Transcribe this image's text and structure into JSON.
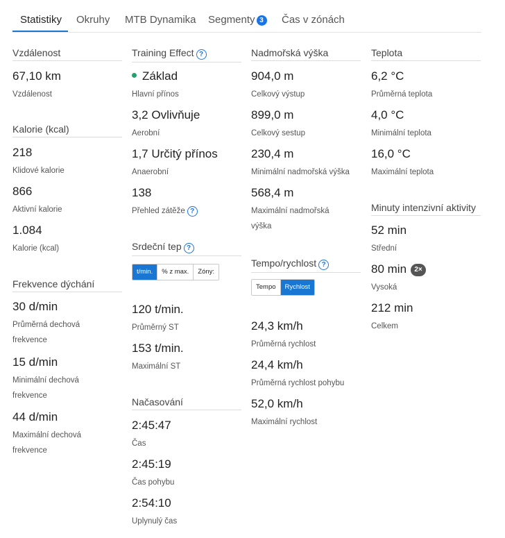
{
  "tabs": [
    {
      "label": "Statistiky"
    },
    {
      "label": "Okruhy"
    },
    {
      "label": "MTB Dynamika"
    },
    {
      "label": "Segmenty",
      "badge": "3"
    },
    {
      "label": "Čas v zónách"
    }
  ],
  "col1": {
    "distance": {
      "title": "Vzdálenost",
      "items": [
        {
          "value": "67,10 km",
          "label": "Vzdálenost"
        }
      ]
    },
    "calories": {
      "title": "Kalorie (kcal)",
      "items": [
        {
          "value": "218",
          "label": "Klidové kalorie"
        },
        {
          "value": "866",
          "label": "Aktivní kalorie"
        },
        {
          "value": "1.084",
          "label": "Kalorie (kcal)"
        }
      ]
    },
    "breathing": {
      "title": "Frekvence dýchání",
      "items": [
        {
          "value": "30 d/min",
          "label": "Průměrná dechová frekvence"
        },
        {
          "value": "15 d/min",
          "label": "Minimální dechová frekvence"
        },
        {
          "value": "44 d/min",
          "label": "Maximální dechová frekvence"
        }
      ]
    }
  },
  "col2": {
    "training": {
      "title": "Training Effect",
      "items": [
        {
          "value": "Základ",
          "label": "Hlavní přínos"
        },
        {
          "value": "3,2 Ovlivňuje",
          "label": "Aerobní"
        },
        {
          "value": "1,7 Určitý přínos",
          "label": "Anaerobní"
        },
        {
          "value": "138",
          "label": "Přehled zátěže"
        }
      ]
    },
    "heart": {
      "title": "Srdeční tep",
      "toggle": [
        "t/min.",
        "% z max.",
        "Zóny:"
      ],
      "items": [
        {
          "value": "120 t/min.",
          "label": "Průměrný ST"
        },
        {
          "value": "153 t/min.",
          "label": "Maximální ST"
        }
      ]
    },
    "timing": {
      "title": "Načasování",
      "items": [
        {
          "value": "2:45:47",
          "label": "Čas"
        },
        {
          "value": "2:45:19",
          "label": "Čas pohybu"
        },
        {
          "value": "2:54:10",
          "label": "Uplynulý čas"
        }
      ]
    }
  },
  "col3": {
    "elevation": {
      "title": "Nadmořská výška",
      "items": [
        {
          "value": "904,0 m",
          "label": "Celkový výstup"
        },
        {
          "value": "899,0 m",
          "label": "Celkový sestup"
        },
        {
          "value": "230,4 m",
          "label": "Minimální nadmořská výška"
        },
        {
          "value": "568,4 m",
          "label": "Maximální nadmořská výška"
        }
      ]
    },
    "speed": {
      "title": "Tempo/rychlost",
      "toggle": [
        "Tempo",
        "Rychlost"
      ],
      "items": [
        {
          "value": "24,3 km/h",
          "label": "Průměrná rychlost"
        },
        {
          "value": "24,4 km/h",
          "label": "Průměrná rychlost pohybu"
        },
        {
          "value": "52,0 km/h",
          "label": "Maximální rychlost"
        }
      ]
    }
  },
  "col4": {
    "temperature": {
      "title": "Teplota",
      "items": [
        {
          "value": "6,2 °C",
          "label": "Průměrná teplota"
        },
        {
          "value": "4,0 °C",
          "label": "Minimální teplota"
        },
        {
          "value": "16,0 °C",
          "label": "Maximální teplota"
        }
      ]
    },
    "intensity": {
      "title": "Minuty intenzivní aktivity",
      "items": [
        {
          "value": "52 min",
          "label": "Střední"
        },
        {
          "value": "80 min",
          "label": "Vysoká",
          "badge": "2×"
        },
        {
          "value": "212 min",
          "label": "Celkem"
        }
      ]
    }
  },
  "colors": {
    "accent": "#1976d2",
    "primary_benefit_dot": "#23a26d"
  }
}
